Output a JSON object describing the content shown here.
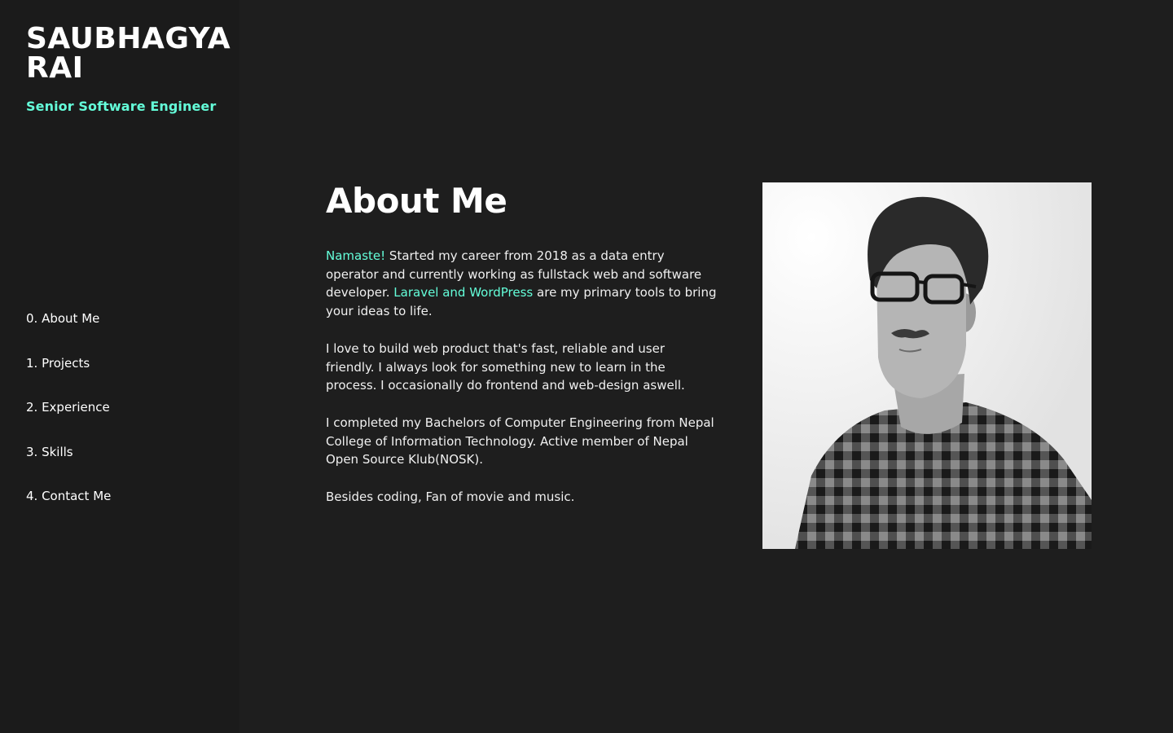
{
  "sidebar": {
    "name_line1": "SAUBHAGYA",
    "name_line2": "RAI",
    "role": "Senior Software Engineer",
    "nav": [
      {
        "label": "0. About Me"
      },
      {
        "label": "1. Projects"
      },
      {
        "label": "2. Experience"
      },
      {
        "label": "3. Skills"
      },
      {
        "label": "4. Contact Me"
      }
    ]
  },
  "about": {
    "title": "About Me",
    "p1_accent1": "Namaste!",
    "p1_text1": " Started my career from 2018 as a data entry operator and currently working as fullstack web and software developer. ",
    "p1_accent2": "Laravel and WordPress",
    "p1_text2": " are my primary tools to bring your ideas to life.",
    "p2": "I love to build web product that's fast, reliable and user friendly. I always look for something new to learn in the process. I occasionally do frontend and web-design aswell.",
    "p3": "I completed my Bachelors of Computer Engineering from Nepal College of Information Technology. Active member of Nepal Open Source Klub(NOSK).",
    "p4": "Besides coding, Fan of movie and music."
  },
  "colors": {
    "accent": "#64ffda",
    "background": "#1e1e1e",
    "sidebar": "#1b1b1b"
  }
}
